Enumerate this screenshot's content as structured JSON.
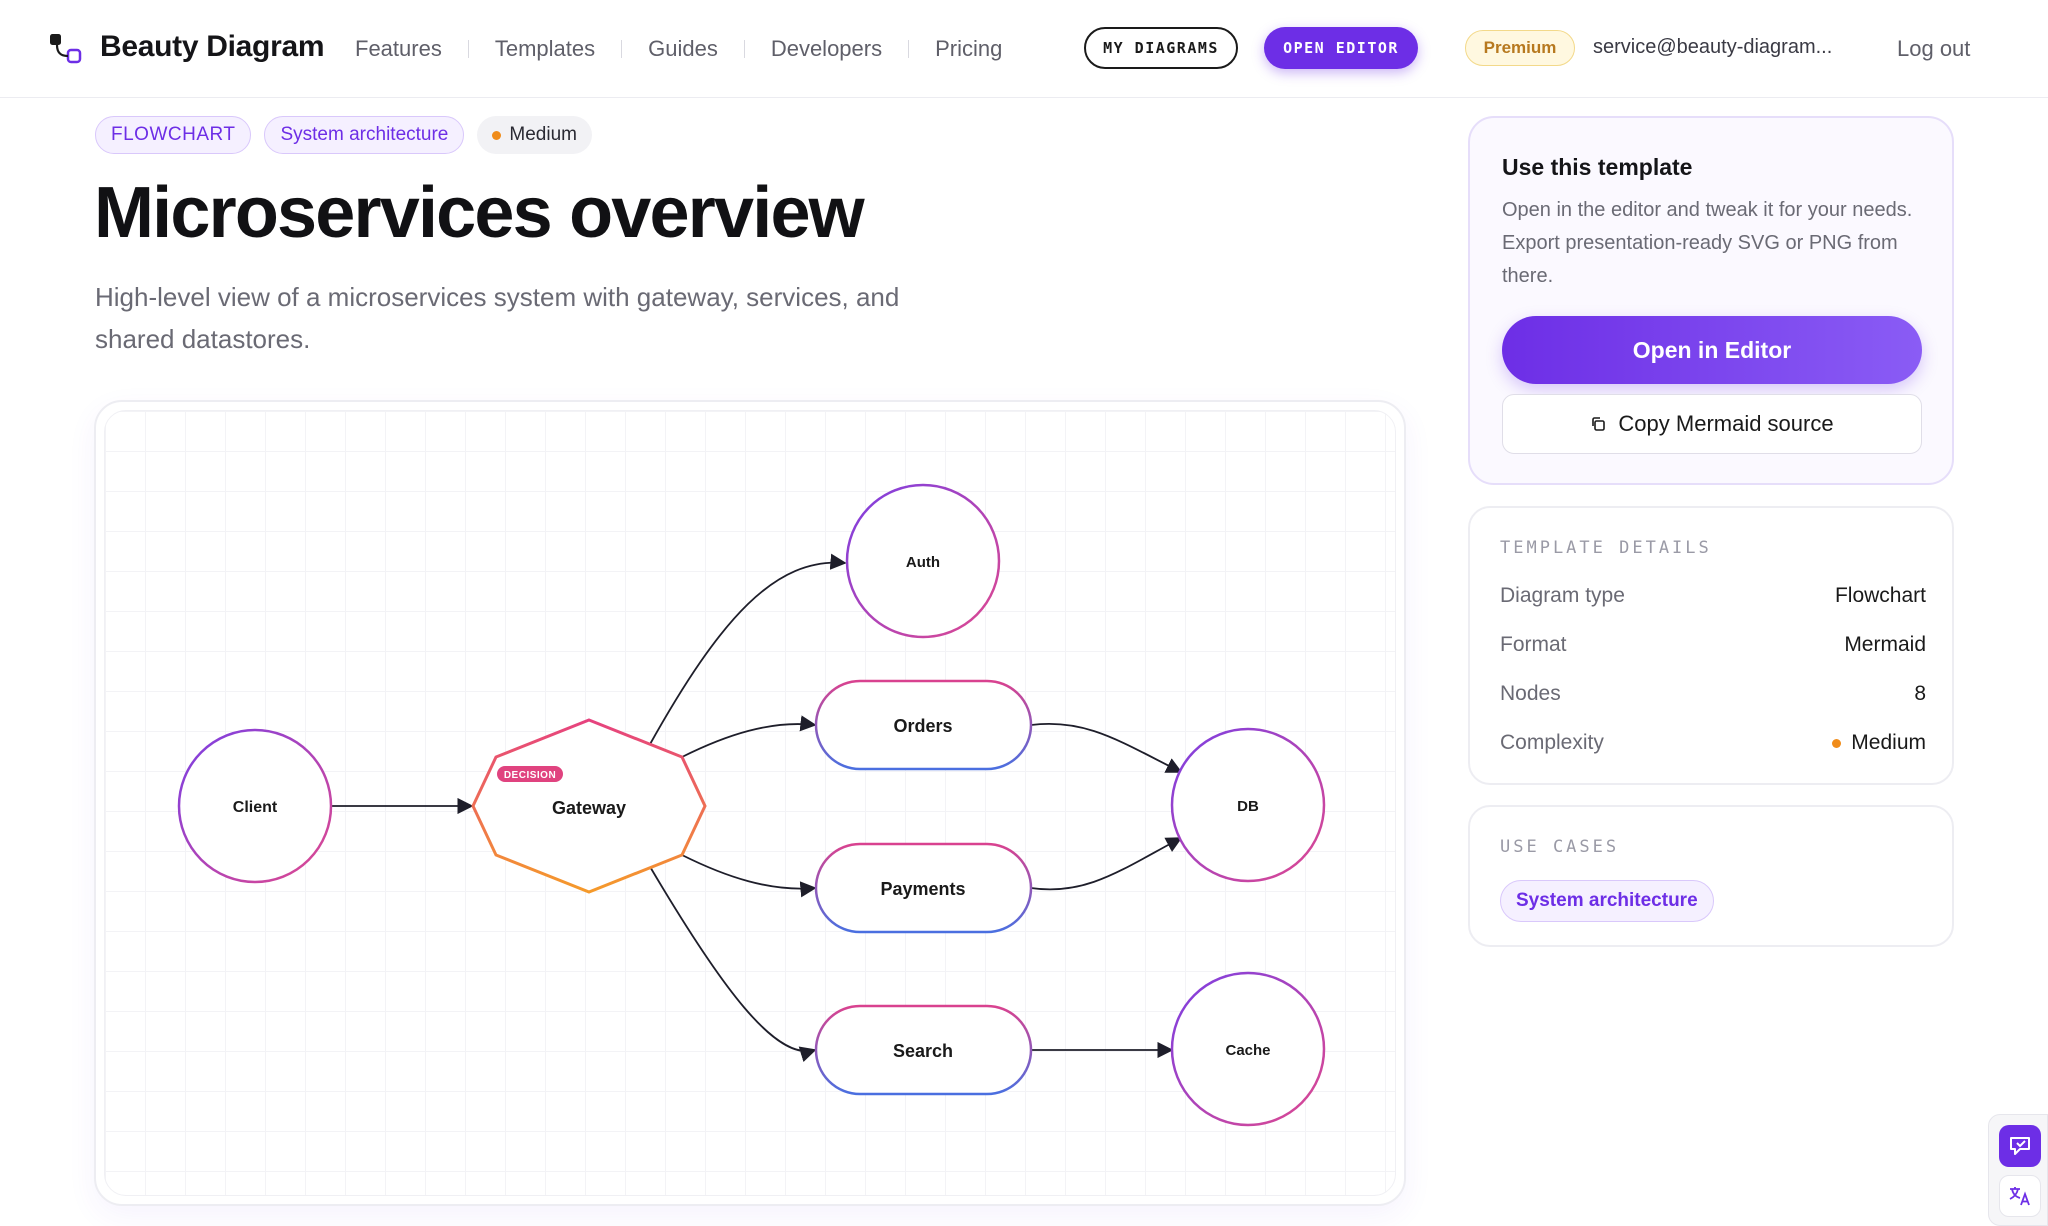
{
  "header": {
    "brand": "Beauty Diagram",
    "nav": [
      "Features",
      "Templates",
      "Guides",
      "Developers",
      "Pricing"
    ],
    "my_diagrams": "MY DIAGRAMS",
    "open_editor": "OPEN EDITOR",
    "premium": "Premium",
    "email": "service@beauty-diagram...",
    "logout": "Log out"
  },
  "tags": {
    "type": "FLOWCHART",
    "category": "System architecture",
    "complexity": "Medium"
  },
  "title": "Microservices overview",
  "description": "High-level view of a microservices system with gateway, services, and shared datastores.",
  "diagram": {
    "decision_badge": "DECISION",
    "nodes": {
      "client": "Client",
      "gateway": "Gateway",
      "auth": "Auth",
      "orders": "Orders",
      "payments": "Payments",
      "search": "Search",
      "db": "DB",
      "cache": "Cache"
    },
    "edges": [
      [
        "Client",
        "Gateway"
      ],
      [
        "Gateway",
        "Auth"
      ],
      [
        "Gateway",
        "Orders"
      ],
      [
        "Gateway",
        "Payments"
      ],
      [
        "Gateway",
        "Search"
      ],
      [
        "Orders",
        "DB"
      ],
      [
        "Payments",
        "DB"
      ],
      [
        "Search",
        "Cache"
      ]
    ]
  },
  "use_template": {
    "title": "Use this template",
    "description": "Open in the editor and tweak it for your needs. Export presentation-ready SVG or PNG from there.",
    "open_button": "Open in Editor",
    "copy_button": "Copy Mermaid source"
  },
  "details": {
    "label": "TEMPLATE DETAILS",
    "rows": [
      {
        "key": "Diagram type",
        "value": "Flowchart"
      },
      {
        "key": "Format",
        "value": "Mermaid"
      },
      {
        "key": "Nodes",
        "value": "8"
      },
      {
        "key": "Complexity",
        "value": "Medium"
      }
    ]
  },
  "use_cases": {
    "label": "USE CASES",
    "items": [
      "System architecture"
    ]
  },
  "colors": {
    "accent": "#6d2ee6",
    "medium_dot": "#f08c1a",
    "premium_text": "#b7791f"
  }
}
